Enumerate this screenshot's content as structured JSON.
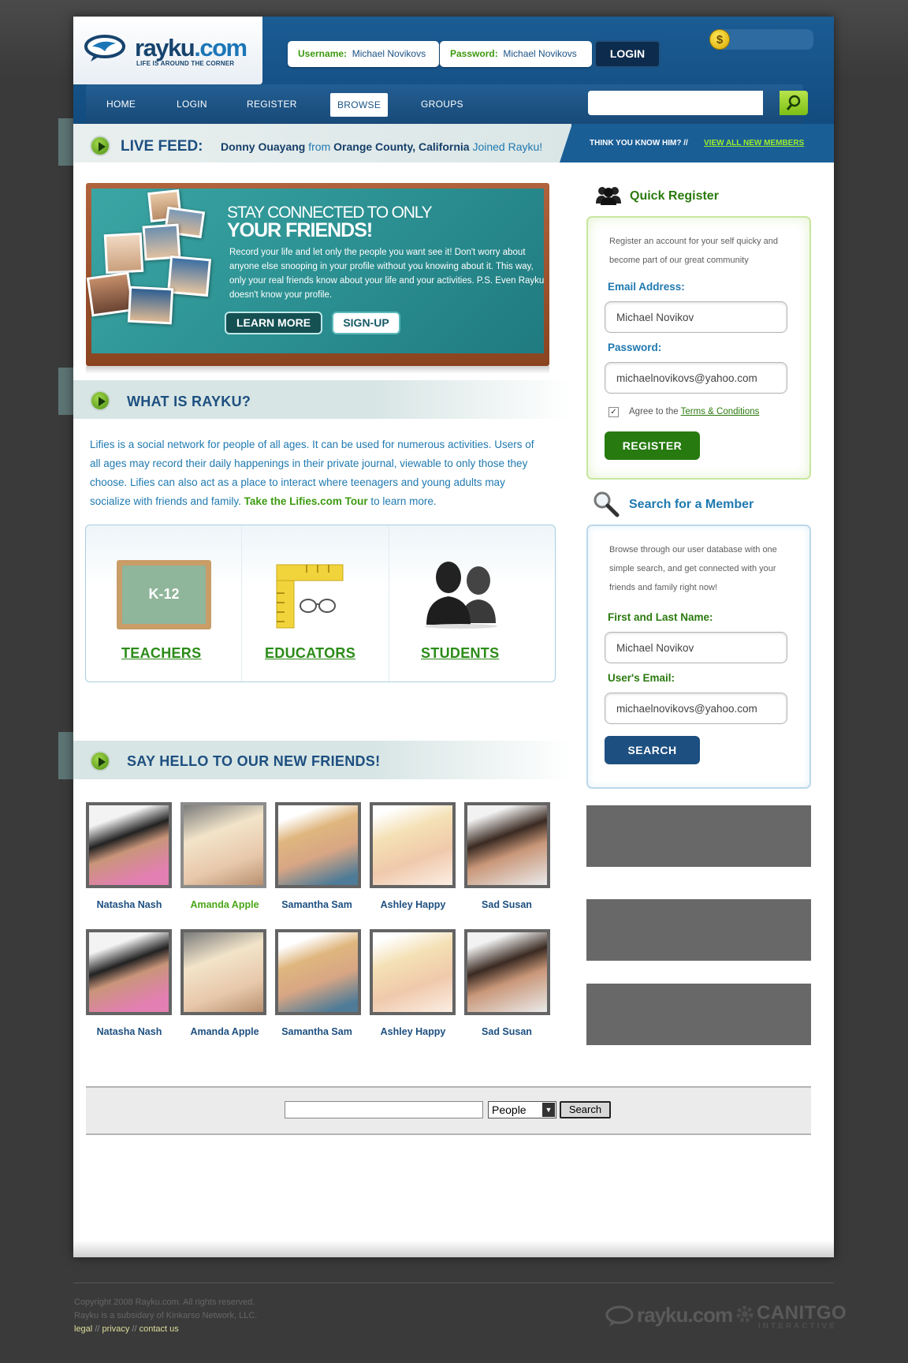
{
  "header": {
    "logo_text": "rayku",
    "logo_dot": ".com",
    "logo_tagline": "LIFE IS AROUND THE CORNER",
    "username_label": "Username:",
    "username_value": "Michael Novikovs",
    "password_label": "Password:",
    "password_value": "Michael Novikovs",
    "login_button": "LOGIN",
    "coin_symbol": "$"
  },
  "nav": {
    "items": [
      "HOME",
      "LOGIN",
      "REGISTER",
      "BROWSE",
      "GROUPS"
    ],
    "active": "BROWSE",
    "search_placeholder": ""
  },
  "live_feed": {
    "label": "LIVE FEED:",
    "name": "Donny Ouayang",
    "from": " from ",
    "location": "Orange County, California",
    "joined": " Joined Rayku!",
    "think": "THINK YOU KNOW HIM?  //",
    "view_all": "VIEW ALL NEW MEMBERS"
  },
  "banner": {
    "title_line1": "STAY CONNECTED TO ONLY",
    "title_line2": "YOUR FRIENDS!",
    "body": "Record your life and let only the people you want see it!  Don't worry about anyone else snooping in your profile without you knowing about it. This way, only your real friends know about your life and your activities. P.S.  Even Rayku doesn't know your profile.",
    "learn_more": "LEARN MORE",
    "signup": "SIGN-UP"
  },
  "what_is": {
    "title": "WHAT IS RAYKU?",
    "body": "Lifies is a social network for people of all ages. It can be used for numerous activities. Users of all ages may record their daily happenings in their private journal, viewable to only those they choose. Lifies can also act as a place to interact where teenagers and young adults may socialize with friends and family. ",
    "tour_link": "Take the Lifies.com Tour",
    "tail": " to learn more."
  },
  "categories": {
    "chalkboard_text": "K-12",
    "items": [
      "TEACHERS",
      "EDUCATORS",
      "STUDENTS"
    ]
  },
  "new_friends": {
    "title": "SAY HELLO TO OUR NEW FRIENDS!",
    "row1": [
      "Natasha Nash",
      "Amanda Apple",
      "Samantha Sam",
      "Ashley Happy",
      "Sad Susan"
    ],
    "row2": [
      "Natasha Nash",
      "Amanda Apple",
      "Samantha Sam",
      "Ashley Happy",
      "Sad Susan"
    ],
    "highlighted": "Amanda Apple"
  },
  "quick_register": {
    "title": "Quick Register",
    "desc": "Register an account for your self quicky and become part of our great community",
    "email_label": "Email Address:",
    "email_value": "Michael Novikov",
    "password_label": "Password:",
    "password_value": "michaelnovikovs@yahoo.com",
    "agree_text": "Agree to the ",
    "terms_link": "Terms & Conditions",
    "checkbox_checked": true,
    "register_button": "REGISTER"
  },
  "search_member": {
    "title": "Search for a Member",
    "desc": "Browse through our user database with one simple search, and get connected with your friends and family right now!",
    "name_label": "First and Last Name:",
    "name_value": "Michael Novikov",
    "email_label": "User's Email:",
    "email_value": "michaelnovikovs@yahoo.com",
    "search_button": "SEARCH"
  },
  "bottom_search": {
    "input_value": "",
    "select_value": "People",
    "button": "Search"
  },
  "footer": {
    "copyright": "Copyright 2008 Rayku.com.  All rights reserved.",
    "subsidiary": "Rayku is a subsidary of Kinkarso Network, LLC.",
    "links": [
      "legal",
      "privacy",
      "contact us"
    ],
    "logo1": "rayku.com",
    "logo2": "CANITGO",
    "logo2_sub": "INTERACTIVE"
  },
  "colors": {
    "header_blue": "#1b5c94",
    "accent_green": "#3d9a10",
    "title_navy": "#1d4f80",
    "text_blue": "#1f79b0"
  }
}
